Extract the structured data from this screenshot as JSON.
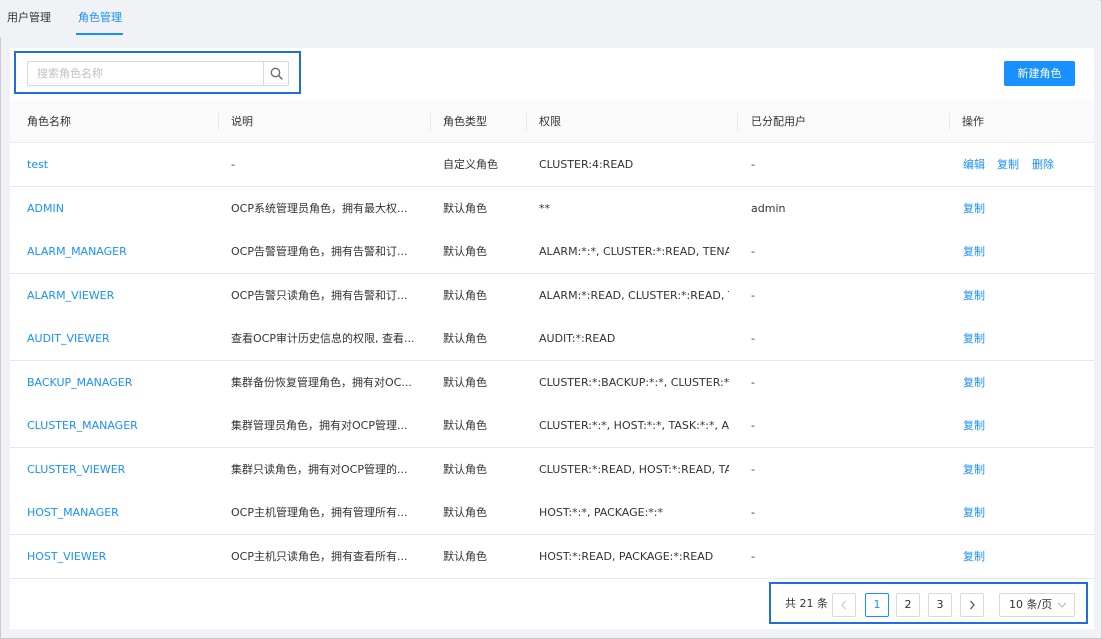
{
  "tabs": [
    {
      "label": "用户管理",
      "active": false
    },
    {
      "label": "角色管理",
      "active": true
    }
  ],
  "search": {
    "placeholder": "搜索角色名称",
    "value": "",
    "icon": "search-icon"
  },
  "toolbar": {
    "new_role_label": "新建角色"
  },
  "colors": {
    "accent": "#1890ff",
    "highlight_border": "#1e6fd9"
  },
  "table": {
    "columns": [
      "角色名称",
      "说明",
      "角色类型",
      "权限",
      "已分配用户",
      "操作"
    ],
    "rows": [
      {
        "name": "test",
        "desc": "-",
        "type": "自定义角色",
        "perm": "CLUSTER:4:READ",
        "users": "-",
        "actions": [
          "编辑",
          "复制",
          "删除"
        ]
      },
      {
        "name": "ADMIN",
        "desc": "OCP系统管理员角色，拥有最大权...",
        "type": "默认角色",
        "perm": "**",
        "users": "admin",
        "actions": [
          "复制"
        ]
      },
      {
        "name": "ALARM_MANAGER",
        "desc": "OCP告警管理角色，拥有告警和订...",
        "type": "默认角色",
        "perm": "ALARM:*:*, CLUSTER:*:READ, TENA...",
        "users": "-",
        "actions": [
          "复制"
        ]
      },
      {
        "name": "ALARM_VIEWER",
        "desc": "OCP告警只读角色，拥有告警和订...",
        "type": "默认角色",
        "perm": "ALARM:*:READ, CLUSTER:*:READ, TE...",
        "users": "-",
        "actions": [
          "复制"
        ]
      },
      {
        "name": "AUDIT_VIEWER",
        "desc": "查看OCP审计历史信息的权限, 查看...",
        "type": "默认角色",
        "perm": "AUDIT:*:READ",
        "users": "-",
        "actions": [
          "复制"
        ]
      },
      {
        "name": "BACKUP_MANAGER",
        "desc": "集群备份恢复管理角色，拥有对OC...",
        "type": "默认角色",
        "perm": "CLUSTER:*:BACKUP:*:*, CLUSTER:*:R...",
        "users": "-",
        "actions": [
          "复制"
        ]
      },
      {
        "name": "CLUSTER_MANAGER",
        "desc": "集群管理员角色，拥有对OCP管理...",
        "type": "默认角色",
        "perm": "CLUSTER:*:*, HOST:*:*, TASK:*:*, ALA...",
        "users": "-",
        "actions": [
          "复制"
        ]
      },
      {
        "name": "CLUSTER_VIEWER",
        "desc": "集群只读角色，拥有对OCP管理的...",
        "type": "默认角色",
        "perm": "CLUSTER:*:READ, HOST:*:READ, TAS...",
        "users": "-",
        "actions": [
          "复制"
        ]
      },
      {
        "name": "HOST_MANAGER",
        "desc": "OCP主机管理角色，拥有管理所有...",
        "type": "默认角色",
        "perm": "HOST:*:*, PACKAGE:*:*",
        "users": "-",
        "actions": [
          "复制"
        ]
      },
      {
        "name": "HOST_VIEWER",
        "desc": "OCP主机只读角色，拥有查看所有...",
        "type": "默认角色",
        "perm": "HOST:*:READ, PACKAGE:*:READ",
        "users": "-",
        "actions": [
          "复制"
        ]
      }
    ]
  },
  "pagination": {
    "total_label": "共 21 条",
    "prev_icon": "chevron-left-icon",
    "next_icon": "chevron-right-icon",
    "pages": [
      "1",
      "2",
      "3"
    ],
    "current_page": "1",
    "page_size_label": "10 条/页"
  }
}
